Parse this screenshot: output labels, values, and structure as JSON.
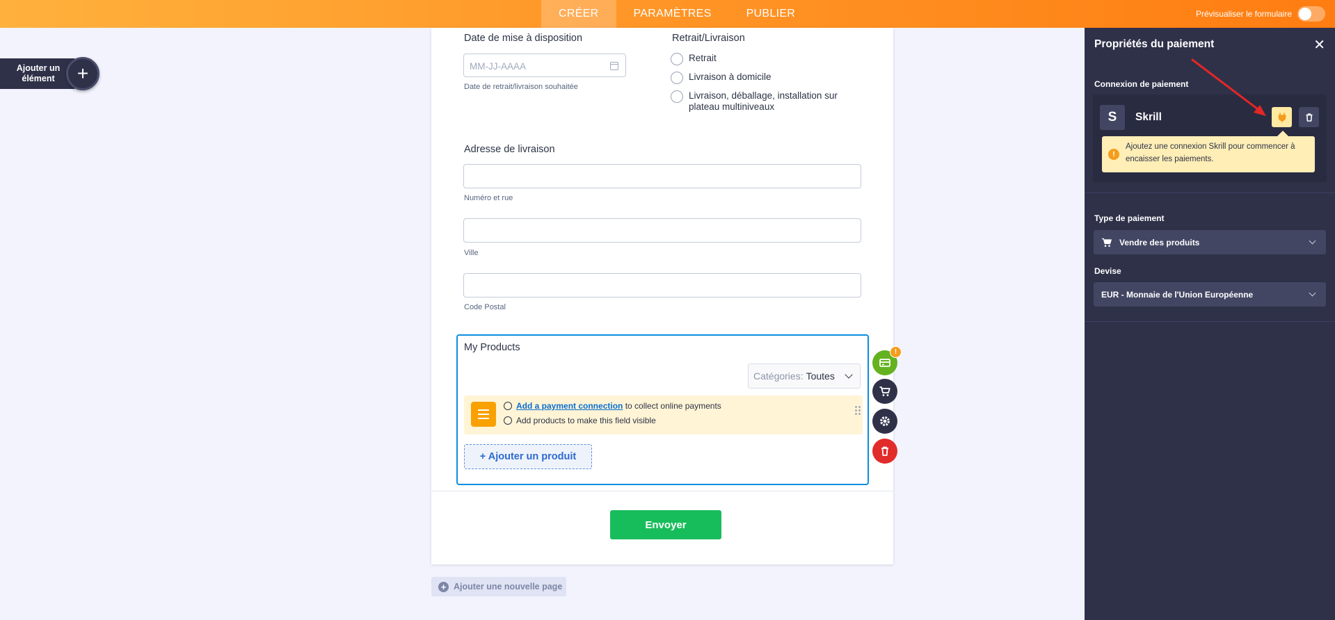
{
  "topbar": {
    "tabs": [
      {
        "label": "CRÉER",
        "active": true
      },
      {
        "label": "PARAMÈTRES",
        "active": false
      },
      {
        "label": "PUBLIER",
        "active": false
      }
    ],
    "preview_label": "Prévisualiser le formulaire",
    "preview_enabled": false
  },
  "add_element": {
    "label": "Ajouter un élément"
  },
  "form": {
    "date": {
      "label": "Date de mise à disposition",
      "placeholder": "MM-JJ-AAAA",
      "sublabel": "Date de retrait/livraison souhaitée"
    },
    "delivery": {
      "label": "Retrait/Livraison",
      "options": [
        "Retrait",
        "Livraison à domicile",
        "Livraison, déballage, installation sur plateau multiniveaux"
      ]
    },
    "address": {
      "label": "Adresse de livraison",
      "street_sublabel": "Numéro et rue",
      "city_sublabel": "Ville",
      "zip_sublabel": "Code Postal"
    },
    "products": {
      "title": "My Products",
      "category_prefix": "Catégories:",
      "category_value": "Toutes",
      "notice_link": "Add a payment connection",
      "notice_line1_rest": "to collect online payments",
      "notice_line2": "Add products to make this field visible",
      "add_product_label": "+ Ajouter un produit"
    },
    "submit_label": "Envoyer",
    "add_page_label": "Ajouter une nouvelle page"
  },
  "side_actions": {
    "badge": "!"
  },
  "panel": {
    "title": "Propriétés du paiement",
    "connection_label": "Connexion de paiement",
    "gateway_name": "Skrill",
    "gateway_initial": "S",
    "tooltip": "Ajoutez une connexion Skrill pour commencer à encaisser les paiements.",
    "payment_type_label": "Type de paiement",
    "payment_type_value": "Vendre des produits",
    "currency_label": "Devise",
    "currency_value": "EUR - Monnaie de l'Union Européenne"
  },
  "colors": {
    "accent_orange": "#ff7d12",
    "panel_bg": "#2f3149",
    "submit_green": "#18bd5b",
    "payment_btn_green": "#64b21f",
    "delete_red": "#e22b2b",
    "field_selected_blue": "#0a8fde",
    "annotation_arrow_red": "#e32626"
  }
}
